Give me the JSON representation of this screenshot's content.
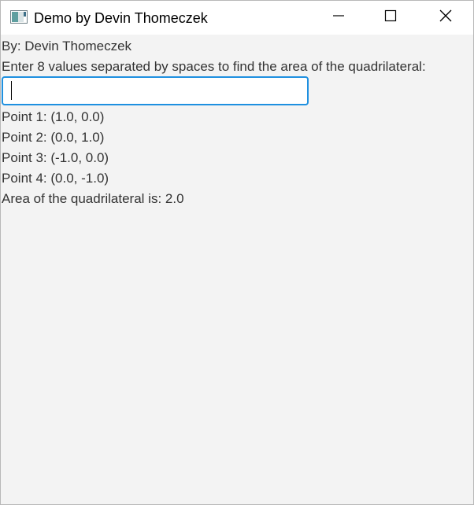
{
  "window": {
    "title": "Demo by Devin Thomeczek"
  },
  "icons": {
    "app": "app-window-icon",
    "minimize": "minimize-icon",
    "maximize": "maximize-icon",
    "close": "close-icon"
  },
  "content": {
    "author": "By: Devin Thomeczek",
    "prompt": "Enter 8 values separated by spaces to find the area of the quadrilateral:",
    "input_value": "",
    "input_placeholder": "",
    "points": [
      "Point 1: (1.0, 0.0)",
      "Point 2: (0.0, 1.0)",
      "Point 3: (-1.0, 0.0)",
      "Point 4: (0.0, -1.0)"
    ],
    "result": "Area of the quadrilateral is: 2.0"
  },
  "colors": {
    "focus_border": "#1e90e0",
    "window_bg": "#f3f3f3",
    "titlebar_bg": "#ffffff"
  }
}
